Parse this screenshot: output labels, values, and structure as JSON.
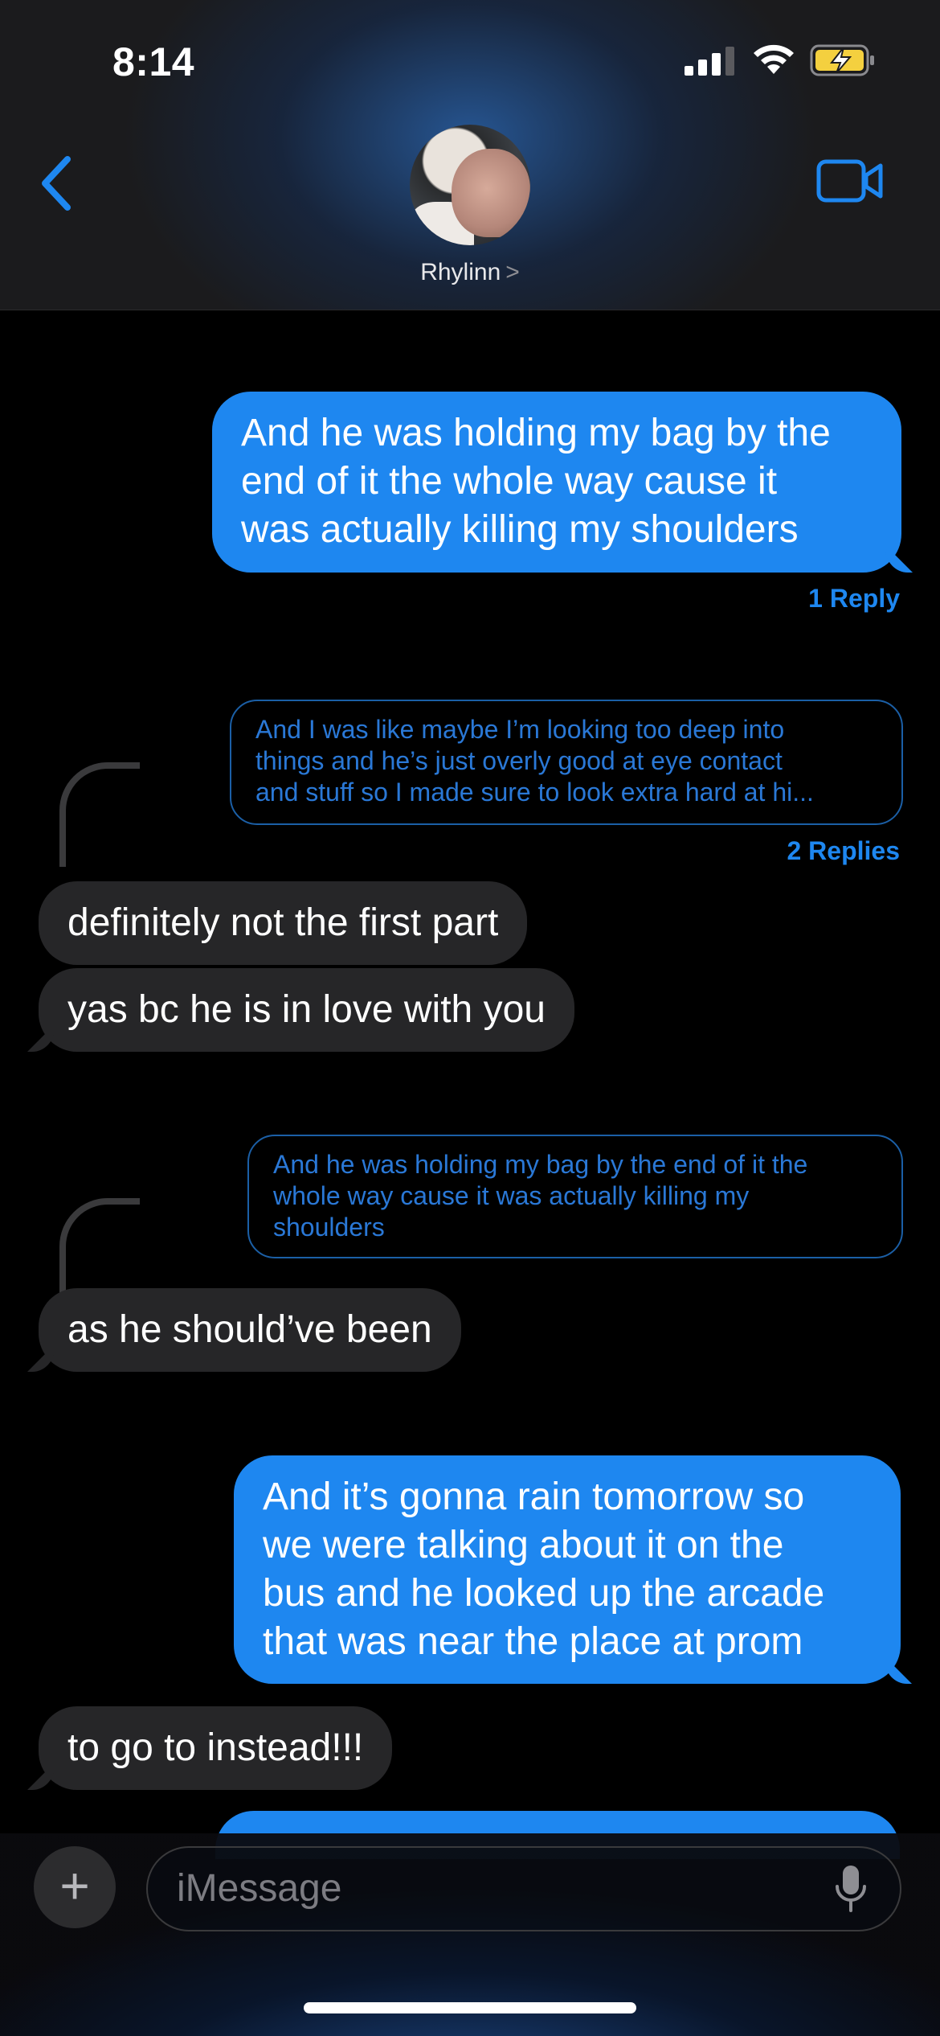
{
  "status_bar": {
    "time": "8:14"
  },
  "header": {
    "contact_name": "Rhylinn",
    "contact_chevron": ">"
  },
  "messages": {
    "m1": {
      "line1": "And he was holding my bag by the",
      "line2": "end of it the whole way cause it",
      "line3": "was actually killing my shoulders"
    },
    "m1_reply_count": "1 Reply",
    "q1": {
      "line1": "And I was like maybe I’m looking too deep into",
      "line2": "things and he’s just overly good at eye contact",
      "line3": "and stuff so I made sure to look extra hard at hi..."
    },
    "q1_reply_count": "2 Replies",
    "m2": "definitely not the first part",
    "m3": "yas bc he is in love with you",
    "q2": {
      "line1": "And he was holding my bag by the end of it the",
      "line2": "whole way cause it was actually killing my",
      "line3": "shoulders"
    },
    "m4": "as he should’ve been",
    "m5": {
      "line1": "And it’s gonna rain tomorrow so",
      "line2": "we were talking about it on the",
      "line3": "bus and he looked up the arcade",
      "line4": "that was near the place at prom"
    },
    "m6": "to go to instead!!!"
  },
  "input": {
    "placeholder": "iMessage",
    "plus_label": "+"
  },
  "colors": {
    "accent": "#1e87f0",
    "incoming_bubble": "#262628",
    "background": "#000000",
    "battery_charging": "#f4d03f"
  },
  "icons": [
    "back-chevron-icon",
    "video-camera-icon",
    "signal-icon",
    "wifi-icon",
    "battery-charging-icon",
    "plus-icon",
    "microphone-icon"
  ]
}
